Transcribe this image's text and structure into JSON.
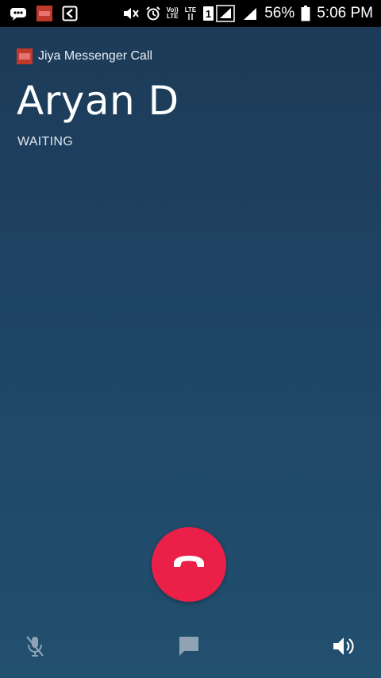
{
  "status_bar": {
    "battery_percent": "56%",
    "time": "5:06 PM",
    "volte_label_top": "Vo))",
    "volte_label_bottom": "LTE",
    "lte_label": "LTE",
    "sim_number": "1",
    "icons": [
      "messages-icon",
      "app-notification-icon",
      "cast-icon",
      "mute-icon",
      "alarm-icon",
      "volte-icon",
      "lte-icon",
      "sim-signal-icon",
      "signal-icon",
      "battery-icon"
    ]
  },
  "app": {
    "name": "Jiya Messenger Call",
    "logo_color": "#c0392b"
  },
  "call": {
    "caller_name": "Aryan D",
    "status": "WAITING"
  },
  "controls": {
    "end_call_color": "#ea2049",
    "icons": [
      "mute-mic-icon",
      "chat-icon",
      "speaker-icon"
    ]
  }
}
